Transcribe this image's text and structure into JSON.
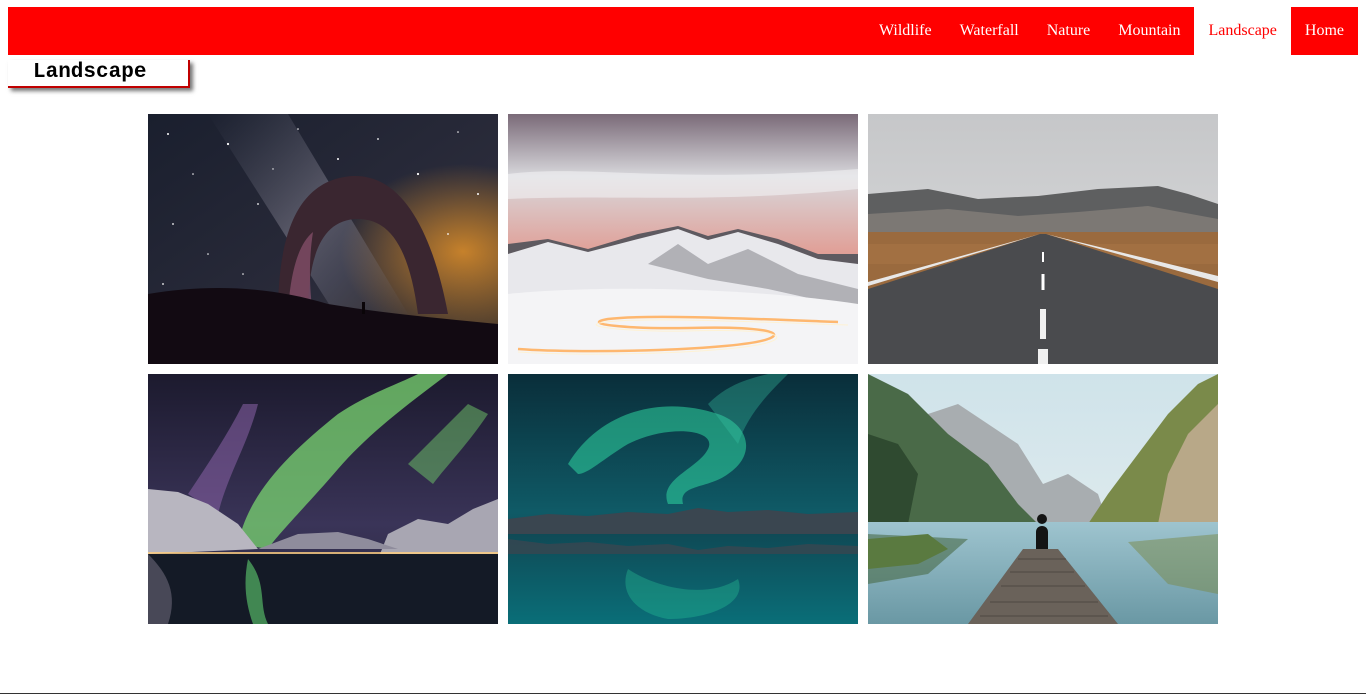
{
  "nav": {
    "items": [
      {
        "label": "Wildlife"
      },
      {
        "label": "Waterfall"
      },
      {
        "label": "Nature"
      },
      {
        "label": "Mountain"
      },
      {
        "label": "Landscape",
        "active": true
      },
      {
        "label": "Home"
      }
    ]
  },
  "section": {
    "title": "Landscape"
  },
  "colors": {
    "accent": "#ff0000",
    "background": "#ffffff"
  },
  "gallery": {
    "photos": [
      {
        "subject": "starry-night-rock-arch-photo"
      },
      {
        "subject": "snowy-mountain-winding-road-light-trails-photo"
      },
      {
        "subject": "straight-road-to-mountains-photo"
      },
      {
        "subject": "aurora-over-fjord-photo"
      },
      {
        "subject": "aurora-over-lake-reflection-photo"
      },
      {
        "subject": "person-on-dock-mountain-lake-photo"
      }
    ]
  }
}
